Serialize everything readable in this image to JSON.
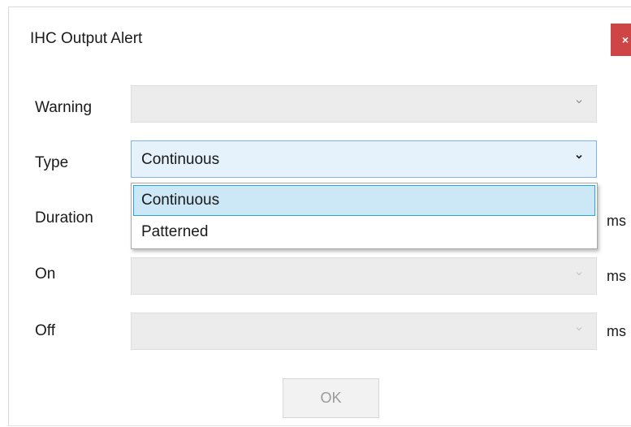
{
  "window": {
    "title": "IHC Output Alert",
    "close_label": "×"
  },
  "form": {
    "warning": {
      "label": "Warning",
      "value": "",
      "enabled": true
    },
    "type": {
      "label": "Type",
      "value": "Continuous",
      "open": true
    },
    "duration": {
      "label": "Duration",
      "value": "",
      "unit": "ms"
    },
    "on": {
      "label": "On",
      "value": "",
      "unit": "ms",
      "enabled": false
    },
    "off": {
      "label": "Off",
      "value": "",
      "unit": "ms",
      "enabled": false
    }
  },
  "type_dropdown": {
    "options": [
      "Continuous",
      "Patterned"
    ],
    "selected": "Continuous"
  },
  "buttons": {
    "ok_label": "OK",
    "ok_enabled": false
  },
  "colors": {
    "close_bg": "#cf4545",
    "selection_border": "#27a4e0",
    "selection_bg": "#cce8f7"
  },
  "icons": {
    "dropdown_chevron": "chevron-down-icon"
  }
}
